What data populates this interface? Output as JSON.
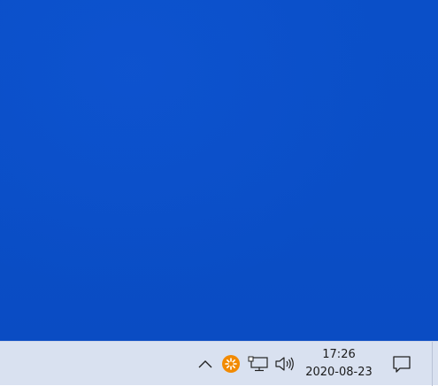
{
  "desktop": {
    "background_color": "#0a4ec6"
  },
  "taskbar": {
    "background_color": "#d9e1f0",
    "tray": {
      "icons": [
        "chevron-up-icon",
        "avast-icon",
        "network-icon",
        "volume-icon",
        "notification-icon"
      ],
      "avast_color": "#f28a00"
    },
    "clock": {
      "time": "17:26",
      "date": "2020-08-23"
    }
  }
}
